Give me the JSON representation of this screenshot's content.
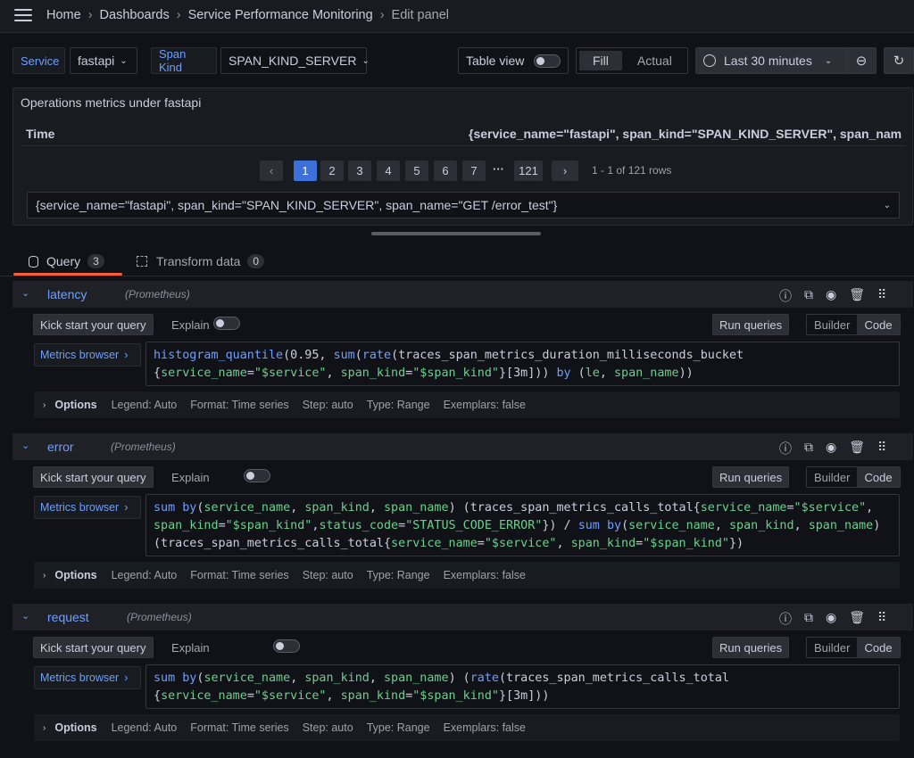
{
  "breadcrumb": {
    "home": "Home",
    "dashboards": "Dashboards",
    "dashboard": "Service Performance Monitoring",
    "current": "Edit panel"
  },
  "variables": {
    "service_label": "Service",
    "service_value": "fastapi",
    "spankind_label": "Span Kind",
    "spankind_value": "SPAN_KIND_SERVER"
  },
  "toolbar": {
    "table_view": "Table view",
    "fill": "Fill",
    "actual": "Actual",
    "time_range": "Last 30 minutes"
  },
  "panel": {
    "title": "Operations metrics under fastapi",
    "col_time": "Time",
    "col_series": "{service_name=\"fastapi\", span_kind=\"SPAN_KIND_SERVER\", span_name=",
    "pages": [
      "1",
      "2",
      "3",
      "4",
      "5",
      "6",
      "7",
      "121"
    ],
    "ellipsis": "···",
    "rows_info": "1 - 1 of 121 rows",
    "series_select": "{service_name=\"fastapi\", span_kind=\"SPAN_KIND_SERVER\", span_name=\"GET /error_test\"}"
  },
  "tabs": {
    "query": "Query",
    "query_count": "3",
    "transform": "Transform data",
    "transform_count": "0"
  },
  "queries": [
    {
      "name": "latency",
      "datasource": "(Prometheus)"
    },
    {
      "name": "error",
      "datasource": "(Prometheus)"
    },
    {
      "name": "request",
      "datasource": "(Prometheus)"
    }
  ],
  "query_controls": {
    "kick_start": "Kick start your query",
    "explain": "Explain",
    "run": "Run queries",
    "builder": "Builder",
    "code": "Code",
    "metrics_browser": "Metrics browser"
  },
  "options": {
    "label": "Options",
    "legend": "Legend: Auto",
    "format": "Format: Time series",
    "step": "Step: auto",
    "type": "Type: Range",
    "exemplars": "Exemplars: false"
  }
}
